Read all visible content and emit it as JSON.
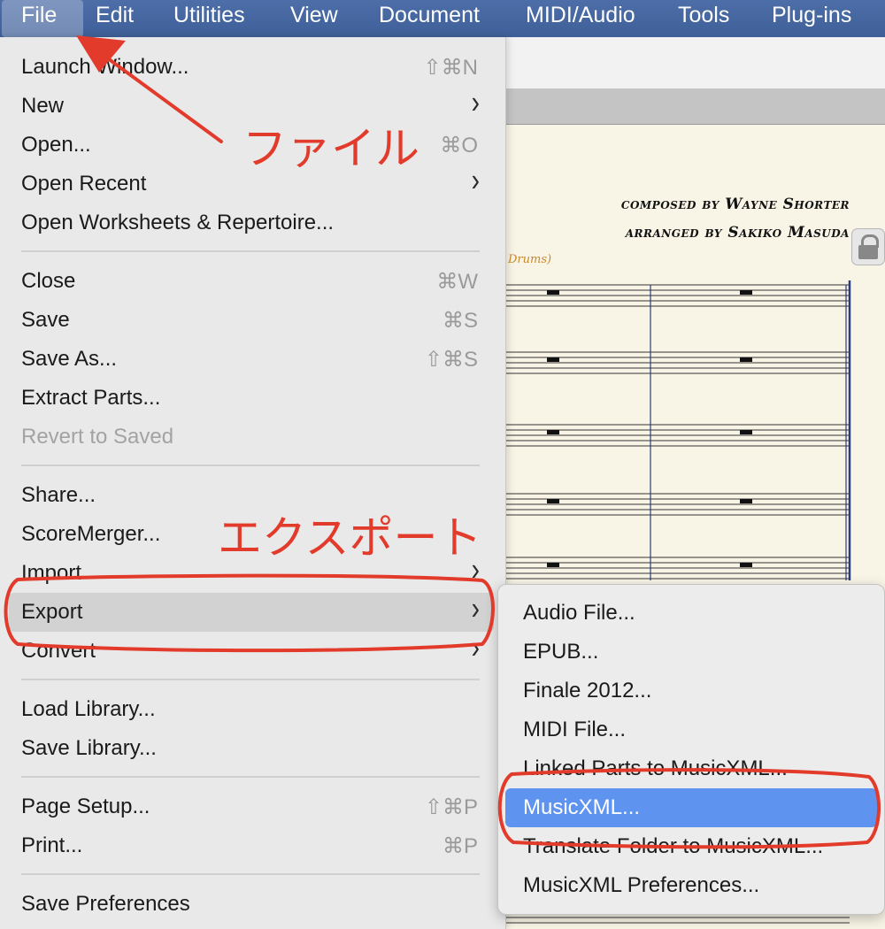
{
  "menubar": {
    "items": [
      "File",
      "Edit",
      "Utilities",
      "View",
      "Document",
      "MIDI/Audio",
      "Tools",
      "Plug-ins"
    ],
    "active": "File"
  },
  "score": {
    "composer_line": "composed by Wayne Shorter",
    "arranger_line": "arranged by Sakiko Masuda",
    "drums_label": "Drums)"
  },
  "file_menu": {
    "launch_window": {
      "label": "Launch Window...",
      "shortcut": "⇧⌘N"
    },
    "new": {
      "label": "New"
    },
    "open": {
      "label": "Open...",
      "shortcut": "⌘O"
    },
    "open_recent": {
      "label": "Open Recent"
    },
    "open_worksheets": {
      "label": "Open Worksheets & Repertoire..."
    },
    "close": {
      "label": "Close",
      "shortcut": "⌘W"
    },
    "save": {
      "label": "Save",
      "shortcut": "⌘S"
    },
    "save_as": {
      "label": "Save As...",
      "shortcut": "⇧⌘S"
    },
    "extract_parts": {
      "label": "Extract Parts..."
    },
    "revert": {
      "label": "Revert to Saved"
    },
    "share": {
      "label": "Share..."
    },
    "score_merger": {
      "label": "ScoreMerger..."
    },
    "import": {
      "label": "Import"
    },
    "export": {
      "label": "Export"
    },
    "convert": {
      "label": "Convert"
    },
    "load_library": {
      "label": "Load Library..."
    },
    "save_library": {
      "label": "Save Library..."
    },
    "page_setup": {
      "label": "Page Setup...",
      "shortcut": "⇧⌘P"
    },
    "print": {
      "label": "Print...",
      "shortcut": "⌘P"
    },
    "save_prefs": {
      "label": "Save Preferences"
    }
  },
  "export_submenu": {
    "audio_file": "Audio File...",
    "epub": "EPUB...",
    "finale_2012": "Finale 2012...",
    "midi_file": "MIDI File...",
    "linked_parts": "Linked Parts to MusicXML...",
    "musicxml": "MusicXML...",
    "translate_folder": "Translate Folder to MusicXML...",
    "musicxml_prefs": "MusicXML Preferences..."
  },
  "annotations": {
    "file_label": "ファイル",
    "export_label": "エクスポート",
    "color": "#e23b2b"
  },
  "colors": {
    "menubar": "#4466a0",
    "selection": "#5e93f0"
  }
}
